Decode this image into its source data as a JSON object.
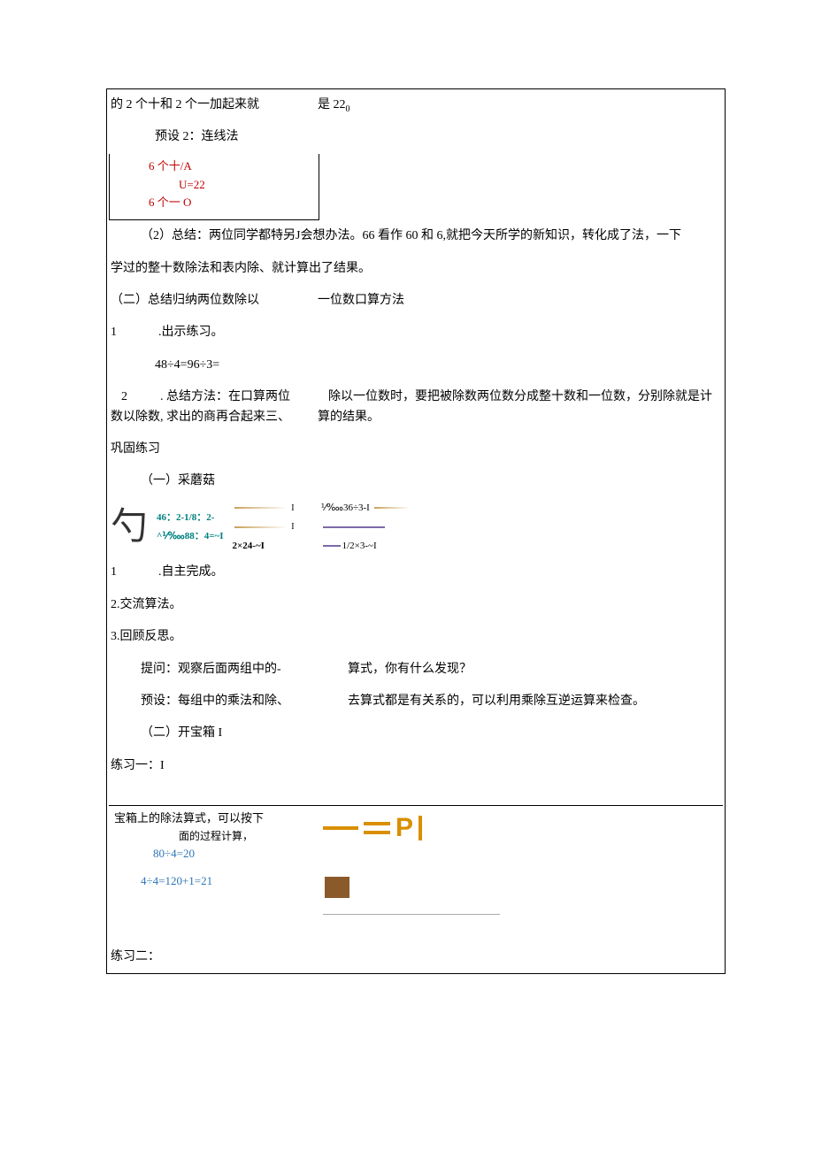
{
  "line1_a": "的 2 个十和 2 个一加起来就",
  "line1_b": "是 22",
  "sub0": "0",
  "preset2": "预设 2：连线法",
  "box1_l1": "6 个十/A",
  "box1_l2": "U=22",
  "box1_l3": "6 个一 O",
  "summary2": "（2）总结：两位同学都特另J会想办法。66 看作 60 和 6,就把今天所学的新知识，转化成了法，一下",
  "summary2b": "学过的整十数除法和表内除、就计算出了结果。",
  "sec2title": "（二）总结归纳两位数除以",
  "sec2title_b": "一位数口算方法",
  "item1": "1",
  "item1_text": ".出示练习。",
  "expr1": "48÷4=96÷3=",
  "item2": "2",
  "item2_text": ". 总结方法：在口算两位",
  "item2_right1": "除以一位数时，要把被除数两位数分成整十数和一位数，分别除就是计",
  "item2_b": "数以除数, 求出的商再合起来三、",
  "item2_right2": "算的结果。",
  "consolidate": "巩固练习",
  "mushroom": "（一）采蘑菇",
  "mush_sym": "勺",
  "mush_a": "46：2-1/8：2-",
  "mush_b": "^⅟‱88：4=~I",
  "mush_c": "2×24-~I",
  "mush_d": "⅟‱36÷3-I",
  "mush_e": "1/2×3-~I",
  "auto1": "1",
  "auto1_text": ".自主完成。",
  "auto2": "2.交流算法。",
  "auto3": "3.回顾反思。",
  "q_left": "提问：观察后面两组中的-",
  "q_right": "算式，你有什么发现？",
  "p_left": "预设：每组中的乘法和除、",
  "p_right": "去算式都是有关系的，可以利用乘除互逆运算来检查。",
  "box2_title": "（二）开宝箱 I",
  "ex1": "练习一：I",
  "ex1_box_a": "宝箱上的除法算式，可以按下",
  "ex1_box_a2": "面的过程计算，",
  "ex1_box_b": "80÷4=20",
  "ex1_box_c": "4÷4=120+1=21",
  "ex2": "练习二："
}
